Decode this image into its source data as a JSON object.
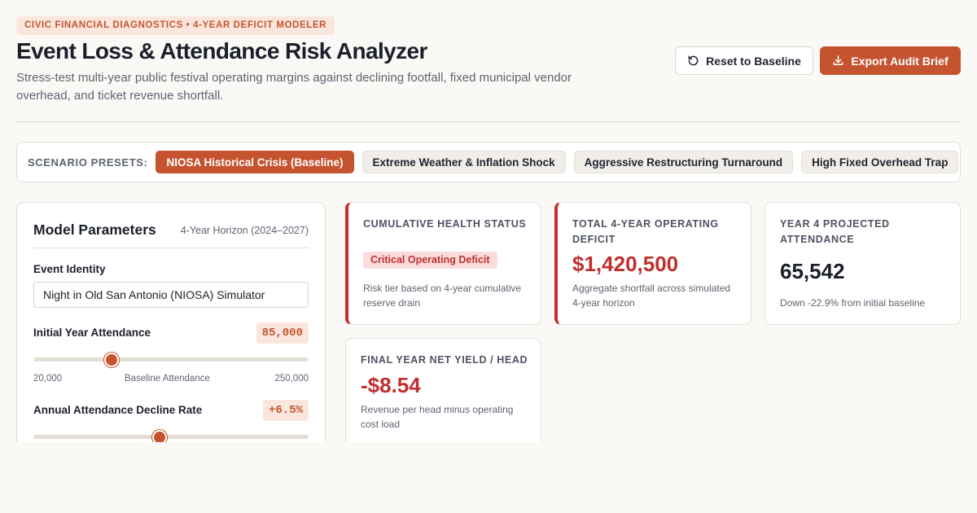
{
  "header": {
    "tag": "CIVIC FINANCIAL DIAGNOSTICS • 4-YEAR DEFICIT MODELER",
    "title": "Event Loss & Attendance Risk Analyzer",
    "subtitle": "Stress-test multi-year public festival operating margins against declining footfall, fixed municipal vendor overhead, and ticket revenue shortfall.",
    "reset_label": "Reset to Baseline",
    "export_label": "Export Audit Brief"
  },
  "presets": {
    "label": "SCENARIO PRESETS:",
    "items": [
      {
        "label": "NIOSA Historical Crisis (Baseline)",
        "active": true
      },
      {
        "label": "Extreme Weather & Inflation Shock",
        "active": false
      },
      {
        "label": "Aggressive Restructuring Turnaround",
        "active": false
      },
      {
        "label": "High Fixed Overhead Trap",
        "active": false
      }
    ]
  },
  "parameters": {
    "title": "Model Parameters",
    "horizon": "4-Year Horizon (2024–2027)",
    "event_identity_label": "Event Identity",
    "event_identity_value": "Night in Old San Antonio (NIOSA) Simulator",
    "initial_attendance": {
      "label": "Initial Year Attendance",
      "display": "85,000",
      "value": 85000,
      "min": 20000,
      "max": 250000,
      "min_label": "20,000",
      "mid_label": "Baseline Attendance",
      "max_label": "250,000"
    },
    "decline_rate": {
      "label": "Annual Attendance Decline Rate",
      "display": "+6.5%",
      "level": 0.46
    }
  },
  "metrics": {
    "health": {
      "label": "CUMULATIVE HEALTH STATUS",
      "badge": "Critical Operating Deficit",
      "note": "Risk tier based on 4-year cumulative reserve drain"
    },
    "deficit": {
      "label": "TOTAL 4-YEAR OPERATING DEFICIT",
      "value": "$1,420,500",
      "note": "Aggregate shortfall across simulated 4-year horizon"
    },
    "attendance": {
      "label": "YEAR 4 PROJECTED ATTENDANCE",
      "value": "65,542",
      "note": "Down -22.9% from initial baseline"
    },
    "yield": {
      "label": "FINAL YEAR NET YIELD / HEAD",
      "value": "-$8.54",
      "note": "Revenue per head minus operating cost load"
    }
  },
  "colors": {
    "accent": "#c65330",
    "danger": "#c12e2e",
    "background": "#faf9f6"
  }
}
